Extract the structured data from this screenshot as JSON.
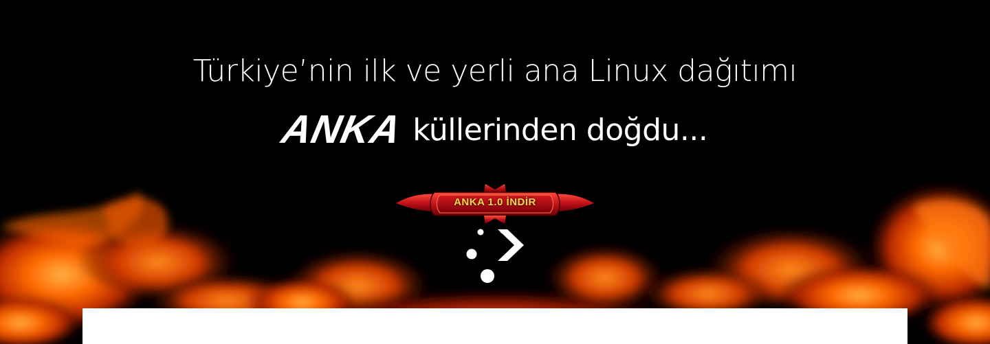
{
  "hero": {
    "headline": "Türkiye’nin ilk ve yerli ana Linux dağıtımı",
    "brand": "ANKA",
    "tagline": "küllerinden doğdu...",
    "download_label": "ANKA 1.0 İNDİR"
  },
  "icons": {
    "scroll": "chevron-right-dots-icon",
    "flames": "flames-background"
  },
  "colors": {
    "background": "#000000",
    "flame": "#ff6a00",
    "badge_red": "#c4121a",
    "badge_text": "#ffd84a",
    "panel": "#ffffff"
  }
}
